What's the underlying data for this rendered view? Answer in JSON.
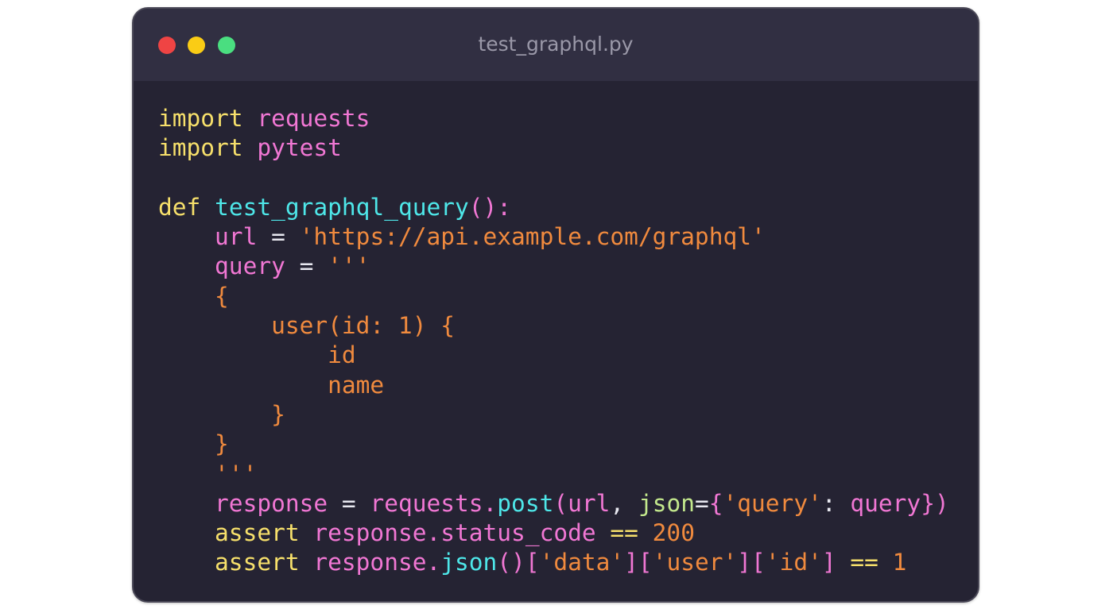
{
  "window": {
    "title": "test_graphql.py"
  },
  "colors": {
    "background": "#252333",
    "titlebar": "#312f42",
    "keyword": "#f7e06b",
    "identifier": "#f177d4",
    "function": "#4ee7e9",
    "string": "#f08a3e",
    "parameter": "#c3e88d",
    "dot_red": "#ef4444",
    "dot_yellow": "#facc15",
    "dot_green": "#4ade80"
  },
  "code_lines": [
    [
      {
        "t": "import",
        "c": "keyword"
      },
      {
        "t": " ",
        "c": "plain"
      },
      {
        "t": "requests",
        "c": "module"
      }
    ],
    [
      {
        "t": "import",
        "c": "keyword"
      },
      {
        "t": " ",
        "c": "plain"
      },
      {
        "t": "pytest",
        "c": "module"
      }
    ],
    [],
    [
      {
        "t": "def",
        "c": "keyword"
      },
      {
        "t": " ",
        "c": "plain"
      },
      {
        "t": "test_graphql_query",
        "c": "func"
      },
      {
        "t": "():",
        "c": "paren"
      }
    ],
    [
      {
        "t": "    ",
        "c": "plain"
      },
      {
        "t": "url",
        "c": "var"
      },
      {
        "t": " = ",
        "c": "op"
      },
      {
        "t": "'https://api.example.com/graphql'",
        "c": "string"
      }
    ],
    [
      {
        "t": "    ",
        "c": "plain"
      },
      {
        "t": "query",
        "c": "var"
      },
      {
        "t": " = ",
        "c": "op"
      },
      {
        "t": "'''",
        "c": "string"
      }
    ],
    [
      {
        "t": "    {",
        "c": "string"
      }
    ],
    [
      {
        "t": "        user(id: 1) {",
        "c": "string"
      }
    ],
    [
      {
        "t": "            id",
        "c": "string"
      }
    ],
    [
      {
        "t": "            name",
        "c": "string"
      }
    ],
    [
      {
        "t": "        }",
        "c": "string"
      }
    ],
    [
      {
        "t": "    }",
        "c": "string"
      }
    ],
    [
      {
        "t": "    '''",
        "c": "string"
      }
    ],
    [
      {
        "t": "    ",
        "c": "plain"
      },
      {
        "t": "response",
        "c": "var"
      },
      {
        "t": " = ",
        "c": "op"
      },
      {
        "t": "requests",
        "c": "var"
      },
      {
        "t": ".",
        "c": "punct"
      },
      {
        "t": "post",
        "c": "func"
      },
      {
        "t": "(",
        "c": "paren"
      },
      {
        "t": "url",
        "c": "var"
      },
      {
        "t": ", ",
        "c": "op"
      },
      {
        "t": "json",
        "c": "param"
      },
      {
        "t": "=",
        "c": "op"
      },
      {
        "t": "{",
        "c": "paren"
      },
      {
        "t": "'query'",
        "c": "string"
      },
      {
        "t": ": ",
        "c": "op"
      },
      {
        "t": "query",
        "c": "var"
      },
      {
        "t": "})",
        "c": "paren"
      }
    ],
    [
      {
        "t": "    ",
        "c": "plain"
      },
      {
        "t": "assert",
        "c": "keyword"
      },
      {
        "t": " ",
        "c": "plain"
      },
      {
        "t": "response",
        "c": "var"
      },
      {
        "t": ".",
        "c": "punct"
      },
      {
        "t": "status_code",
        "c": "var"
      },
      {
        "t": " == ",
        "c": "keyword"
      },
      {
        "t": "200",
        "c": "number"
      }
    ],
    [
      {
        "t": "    ",
        "c": "plain"
      },
      {
        "t": "assert",
        "c": "keyword"
      },
      {
        "t": " ",
        "c": "plain"
      },
      {
        "t": "response",
        "c": "var"
      },
      {
        "t": ".",
        "c": "punct"
      },
      {
        "t": "json",
        "c": "func"
      },
      {
        "t": "()[",
        "c": "paren"
      },
      {
        "t": "'data'",
        "c": "string"
      },
      {
        "t": "][",
        "c": "paren"
      },
      {
        "t": "'user'",
        "c": "string"
      },
      {
        "t": "][",
        "c": "paren"
      },
      {
        "t": "'id'",
        "c": "string"
      },
      {
        "t": "]",
        "c": "paren"
      },
      {
        "t": " == ",
        "c": "keyword"
      },
      {
        "t": "1",
        "c": "number"
      }
    ]
  ]
}
